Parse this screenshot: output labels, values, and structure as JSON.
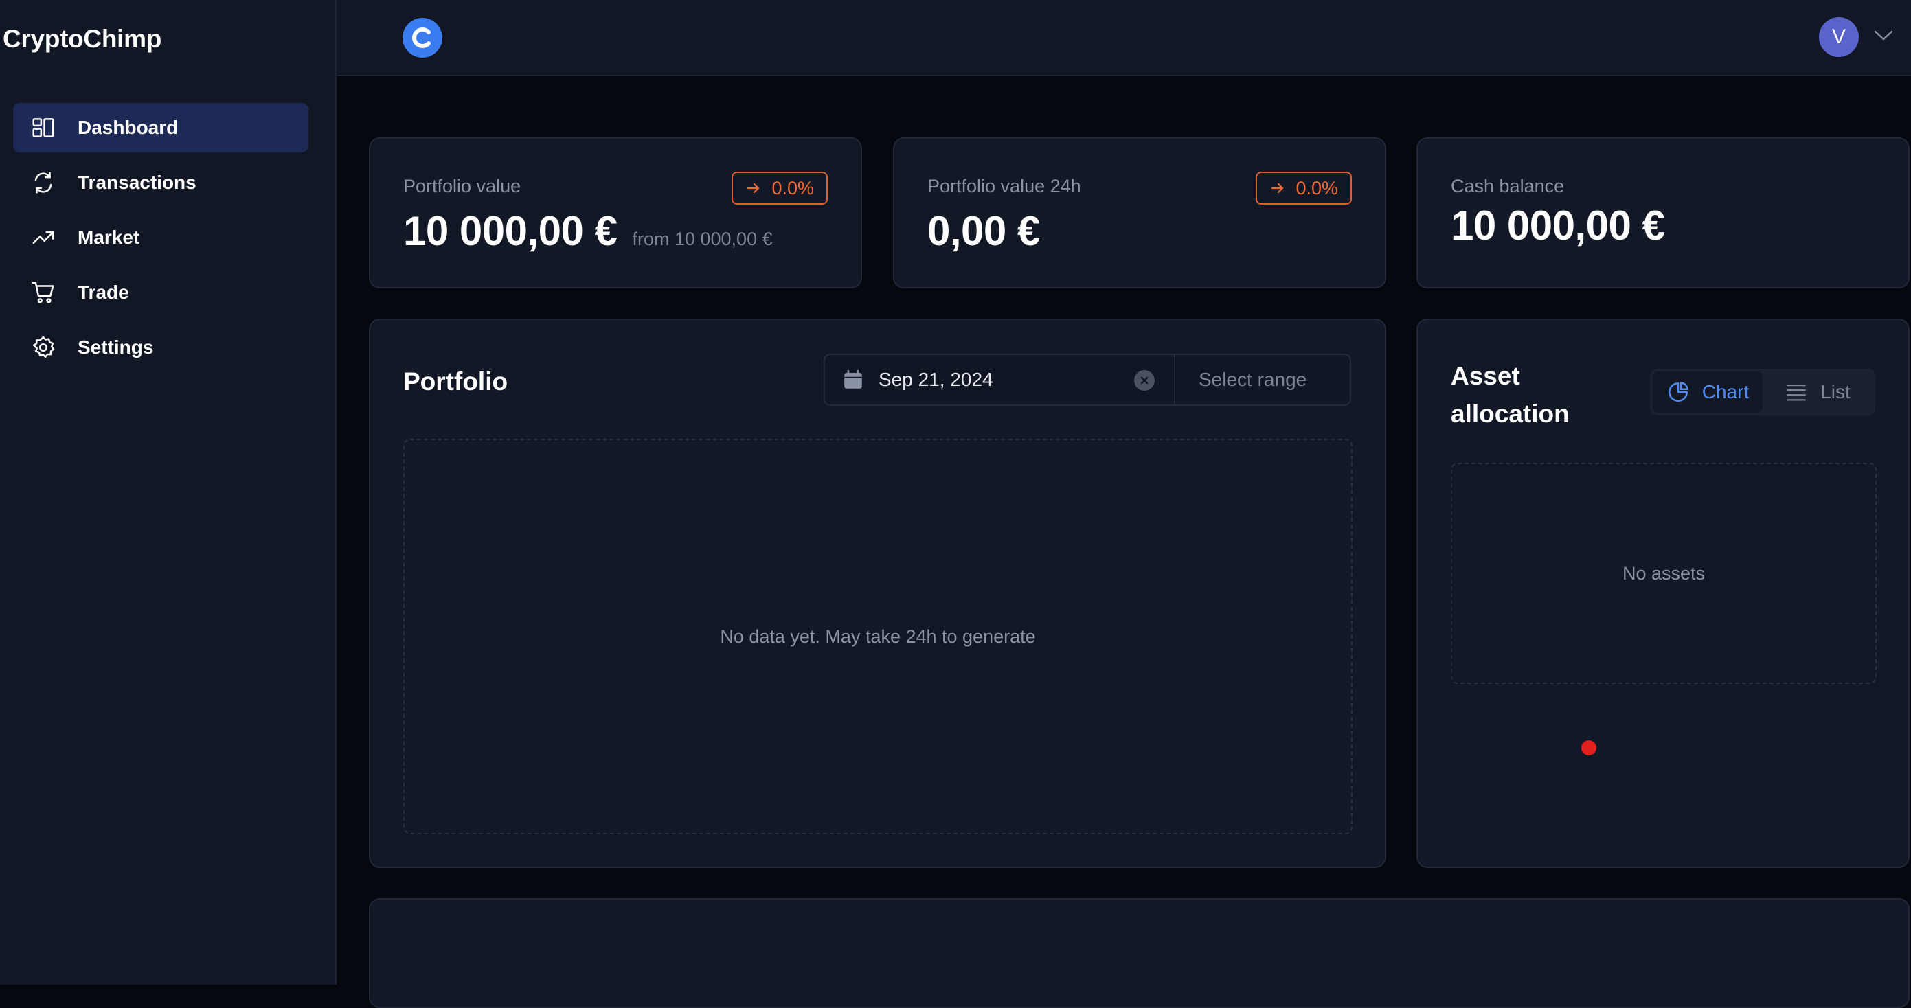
{
  "app": {
    "brand": "CryptoChimp"
  },
  "sidebar": {
    "items": [
      {
        "label": "Dashboard",
        "icon": "dashboard-icon",
        "active": true
      },
      {
        "label": "Transactions",
        "icon": "refresh-icon",
        "active": false
      },
      {
        "label": "Market",
        "icon": "trending-up-icon",
        "active": false
      },
      {
        "label": "Trade",
        "icon": "cart-icon",
        "active": false
      },
      {
        "label": "Settings",
        "icon": "gear-icon",
        "active": false
      }
    ]
  },
  "header": {
    "logo_letter": "C",
    "avatar_initial": "V"
  },
  "stats": {
    "portfolio_value": {
      "label": "Portfolio value",
      "value": "10 000,00 €",
      "from": "from 10 000,00 €",
      "change": "0.0%"
    },
    "portfolio_24h": {
      "label": "Portfolio value 24h",
      "value": "0,00 €",
      "change": "0.0%"
    },
    "cash_balance": {
      "label": "Cash balance",
      "value": "10 000,00 €"
    }
  },
  "portfolio": {
    "title": "Portfolio",
    "date_start": "Sep 21, 2024",
    "date_end_placeholder": "Select range",
    "empty_message": "No data yet. May take 24h to generate"
  },
  "allocation": {
    "title_line1": "Asset",
    "title_line2": "allocation",
    "toggle_chart": "Chart",
    "toggle_list": "List",
    "empty_message": "No assets"
  },
  "colors": {
    "accent": "#4f8bf2",
    "badge": "#f06a33",
    "active_nav": "#1d2a55",
    "marker": "#e21f1f"
  }
}
